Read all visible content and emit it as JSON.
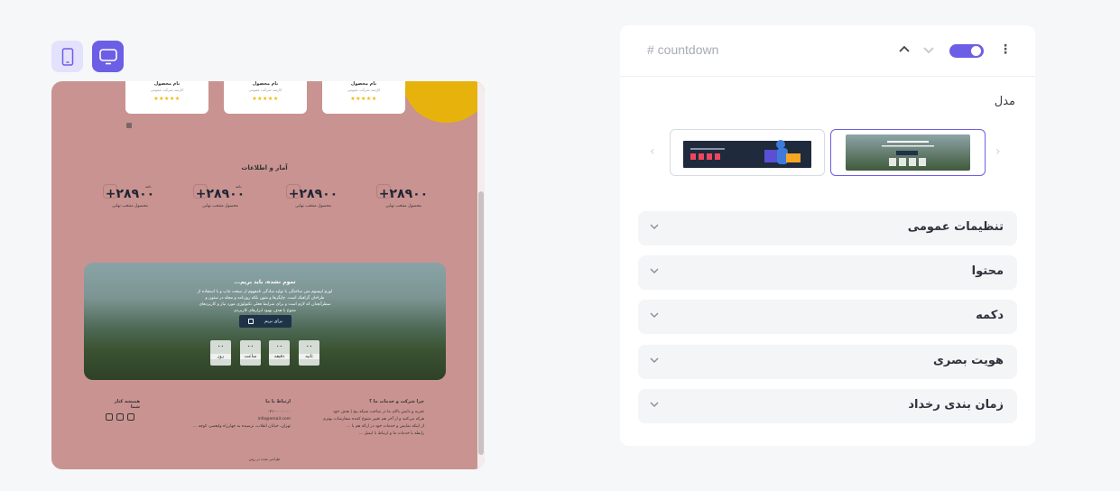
{
  "device_switch": {
    "mobile_icon": "mobile-phone-icon",
    "desktop_icon": "desktop-monitor-icon"
  },
  "preview": {
    "top_cards": [
      {
        "title": "نام محصول",
        "subtitle": "کارمند شرکت عمومی",
        "stars": "★★★★★"
      },
      {
        "title": "نام محصول",
        "subtitle": "کارمند شرکت عمومی",
        "stars": "★★★★★"
      },
      {
        "title": "نام محصول",
        "subtitle": "کارمند شرکت عمومی",
        "stars": "★★★★★"
      }
    ],
    "stats_title": "آمار و اطلاعات",
    "stats": [
      {
        "value": "+۲۸۹۰۰",
        "label": "محصول منتخب نهایی",
        "tag": "نامه"
      },
      {
        "value": "+۲۸۹۰۰",
        "label": "محصول منتخب نهایی",
        "tag": "نامه"
      },
      {
        "value": "+۲۸۹۰۰",
        "label": "محصول منتخب نهایی",
        "tag": ""
      },
      {
        "value": "+۲۸۹۰۰",
        "label": "محصول منتخب نهایی",
        "tag": ""
      }
    ],
    "countdown": {
      "heading": "تموم نشده، باید بریم...",
      "paragraph": "لورم ایپسوم متن ساختگی با تولید سادگی نامفهوم از صنعت چاپ و با استفاده از طراحان گرافیک است. چاپگرها و متون بلکه روزنامه و مجله در ستون و سطرآنچنان که لازم است و برای شرایط فعلی تکنولوژی مورد نیاز و کاربردهای متنوع با هدف بهبود ابزارهای کاربردی",
      "button_label": "برای بریم",
      "units": [
        {
          "value": "۰۰",
          "label": "ثانیه"
        },
        {
          "value": "۰۰",
          "label": "دقیقه"
        },
        {
          "value": "۰۰",
          "label": "ساعت"
        },
        {
          "value": "۰۰",
          "label": "روز"
        }
      ]
    },
    "footer": {
      "col1_title": "چرا شرکت و خدمات ما ؟",
      "col1_lines": [
        "تجربه و دانش بالای ما در ساخت شبکه بیخ | هدف خود",
        "هرکه می‌کنید و از آخر هم تغییر متنوع کننده سفارشات بهتری",
        "از اینکه نمایش و خدمات خود در ارائه هم با ...",
        "رابطه با خدمات ما و ارتباط با ایمیل ..."
      ],
      "col2_title": "ارتباط با ما",
      "col2_lines": [
        "۰۲۱-۰۰۰۰۰۰۰",
        "info@email.com",
        "تهران، خیابان انقلاب، نرسیده به چهارراه ولیعصر، کوچه ..."
      ],
      "col3_title": "همیشه کنار شما",
      "copyright": "طراحی شده در ریتن"
    }
  },
  "panel": {
    "title": "# countdown",
    "toggle_on": true,
    "section_label": "مدل",
    "accordions": [
      "تنظیمات عمومی",
      "محتوا",
      "دکمه",
      "هویت بصری",
      "زمان بندی رخداد"
    ]
  },
  "colors": {
    "accent": "#6c5fe6",
    "preview_bg": "#c99391",
    "highlight": "#e8b20d"
  }
}
